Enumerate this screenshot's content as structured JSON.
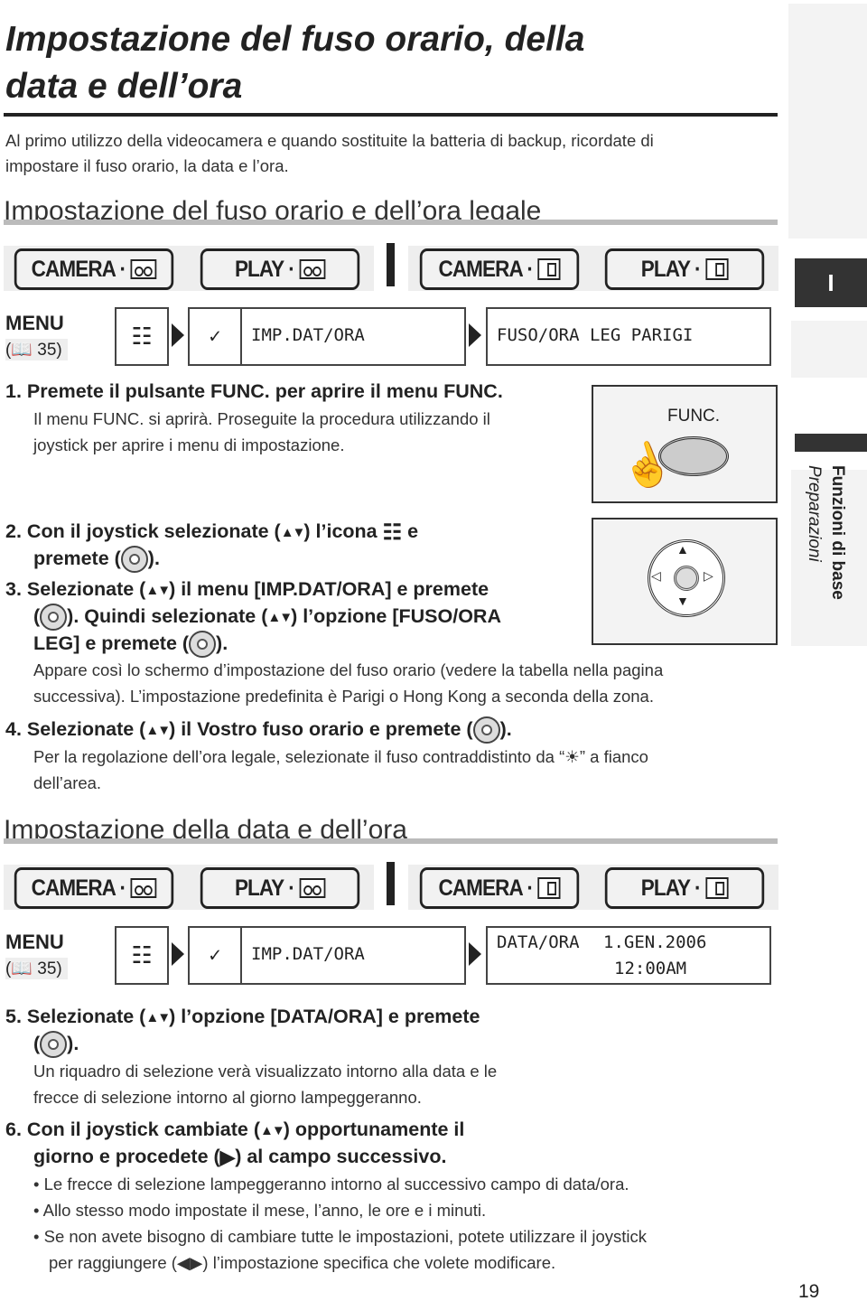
{
  "title": {
    "line1": "Impostazione del fuso orario, della",
    "line2": "data e dell’ora"
  },
  "intro": {
    "line1": "Al primo utilizzo della videocamera e quando sostituite la batteria di backup, ricordate di",
    "line2": "impostare il fuso orario, la data e l’ora."
  },
  "section1": {
    "heading": "Impostazione del fuso orario e dell’ora legale",
    "modes": [
      "CAMERA ·",
      "PLAY ·",
      "CAMERA ·",
      "PLAY ·"
    ],
    "menu": {
      "label": "MENU",
      "page_ref": "35",
      "item": "IMP.DAT/ORA",
      "setting": "FUSO/ORA LEG PARIGI"
    }
  },
  "steps": {
    "s1": {
      "num": "1.",
      "text": "Premete il pulsante FUNC. per aprire il menu FUNC.",
      "p1": "Il menu FUNC. si aprirà. Proseguite la procedura utilizzando il",
      "p2": "joystick per aprire i menu di impostazione."
    },
    "s2": {
      "num": "2.",
      "a": "Con il joystick selezionate (",
      "b": ") l’icona",
      "c": "e",
      "d": "premete (",
      "e": ")."
    },
    "s3": {
      "num": "3.",
      "a": "Selezionate (",
      "b": ") il menu [IMP.DAT/ORA] e premete",
      "c": "(",
      "d": "). Quindi selezionate (",
      "e": ") l’opzione [FUSO/ORA",
      "f": "LEG] e premete (",
      "g": ").",
      "p1": "Appare così lo schermo d’impostazione del fuso orario (vedere la tabella nella pagina",
      "p2": "successiva). L’impostazione predefinita è Parigi o Hong Kong a seconda della zona."
    },
    "s4": {
      "num": "4.",
      "a": "Selezionate (",
      "b": ") il Vostro fuso orario e premete (",
      "c": ").",
      "p1a": "Per la regolazione dell’ora legale, selezionate il fuso contraddistinto da “",
      "p1b": "” a fianco",
      "p2": "dell’area."
    },
    "s5": {
      "num": "5.",
      "a": "Selezionate (",
      "b": ") l’opzione [DATA/ORA] e premete",
      "c": "(",
      "d": ").",
      "p1": "Un riquadro di selezione verà visualizzato intorno alla data e le",
      "p2": "frecce di selezione intorno al giorno lampeggeranno."
    },
    "s6": {
      "num": "6.",
      "a": "Con il joystick cambiate (",
      "b": ") opportunamente il",
      "c": "giorno e procedete (",
      "d": ") al campo successivo.",
      "bullets": [
        "Le frecce di selezione lampeggeranno intorno al successivo campo di data/ora.",
        "Allo stesso modo impostate il mese, l’anno, le ore e i minuti.",
        "Se non avete bisogno di cambiare tutte le impostazioni, potete utilizzare il joystick"
      ],
      "b3a": "per raggiungere (",
      "b3b": ") l’impostazione specifica che volete modificare."
    }
  },
  "section2": {
    "heading": "Impostazione della data e dell’ora",
    "modes": [
      "CAMERA ·",
      "PLAY ·",
      "CAMERA ·",
      "PLAY ·"
    ],
    "menu": {
      "label": "MENU",
      "page_ref": "35",
      "item": "IMP.DAT/ORA",
      "setting_label": "DATA/ORA",
      "date": "1.GEN.2006",
      "time": "12:00AM"
    }
  },
  "figure": {
    "func_label": "FUNC."
  },
  "sidebar": {
    "tab": "I",
    "section": "Funzioni di base",
    "subsection": "Preparazioni"
  },
  "page_number": "19",
  "icons": {
    "up_down": "▲▼",
    "right": "▶",
    "left_right": "◀▶",
    "sun": "☀"
  }
}
